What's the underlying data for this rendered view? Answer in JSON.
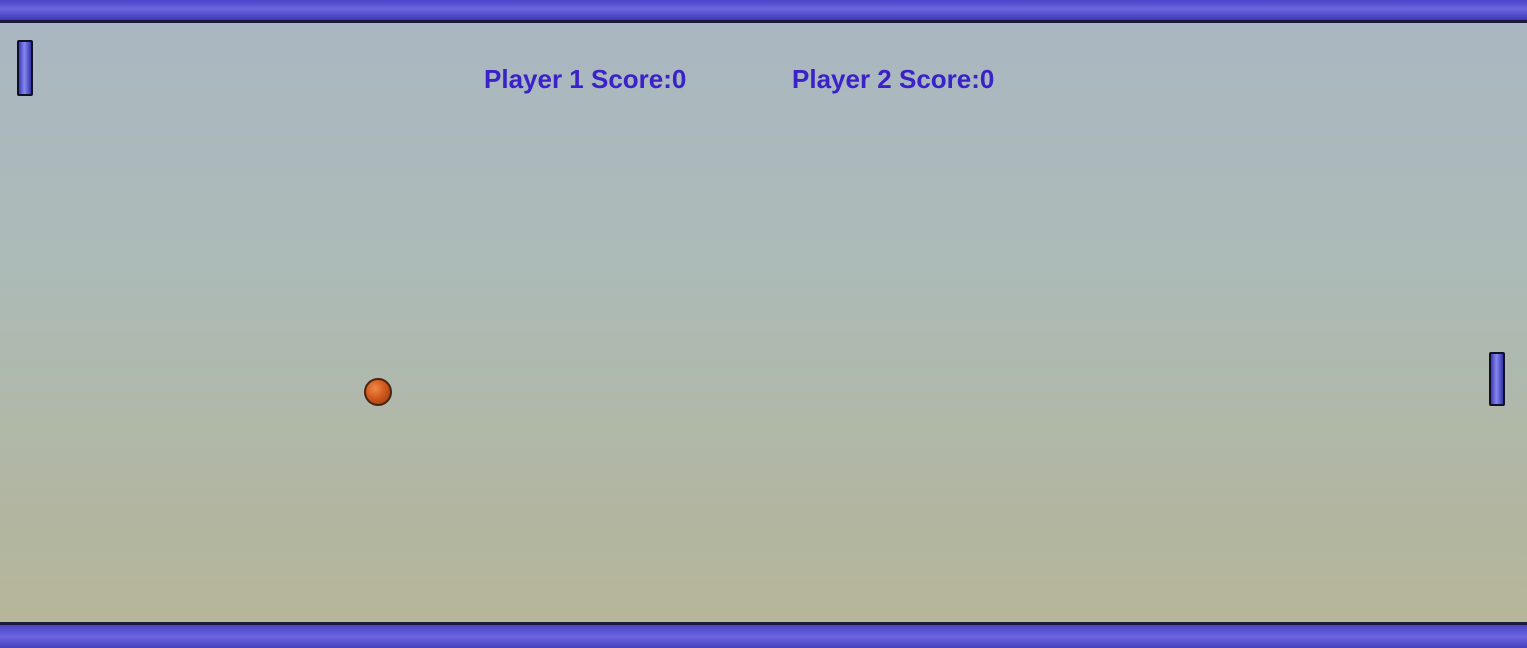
{
  "scoreboard": {
    "player1": {
      "label": "Player 1 Score:",
      "score": "0"
    },
    "player2": {
      "label": "Player 2 Score:",
      "score": "0"
    }
  },
  "colors": {
    "wall": "#4a44c8",
    "paddle": "#5c5cd8",
    "ball": "#d25a1e",
    "score_text": "#3a22c8"
  }
}
